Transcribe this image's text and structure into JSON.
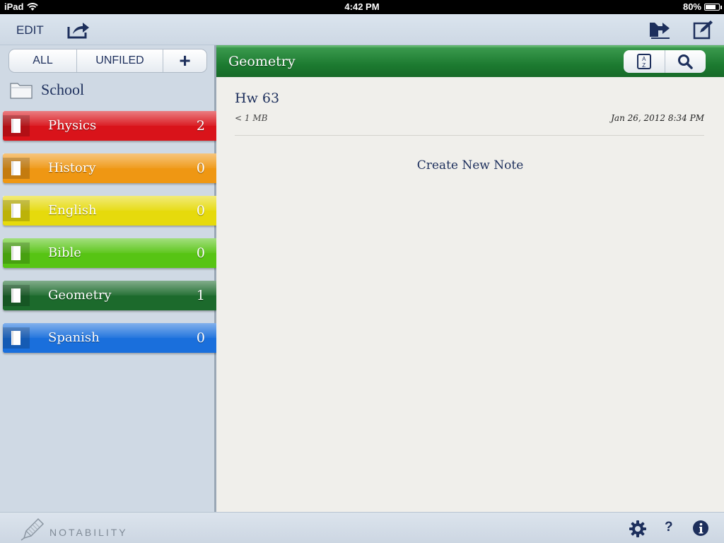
{
  "status_bar": {
    "carrier": "iPad",
    "time": "4:42 PM",
    "battery": "80%",
    "battery_level": 0.8
  },
  "toolbar": {
    "edit_label": "EDIT",
    "share_icon": "share-icon",
    "import_icon": "import-icon",
    "compose_icon": "compose-icon"
  },
  "sidebar": {
    "filters": {
      "all_label": "ALL",
      "unfiled_label": "UNFILED",
      "add_label": "+"
    },
    "category": {
      "label": "School",
      "icon": "folder-icon"
    },
    "subjects": [
      {
        "label": "Physics",
        "count": "2",
        "color": "#d9131a",
        "selected": false
      },
      {
        "label": "History",
        "count": "0",
        "color": "#ef9713",
        "selected": false
      },
      {
        "label": "English",
        "count": "0",
        "color": "#e6da0c",
        "selected": false
      },
      {
        "label": "Bible",
        "count": "0",
        "color": "#57c414",
        "selected": false
      },
      {
        "label": "Geometry",
        "count": "1",
        "color": "#1c6a2c",
        "selected": true
      },
      {
        "label": "Spanish",
        "count": "0",
        "color": "#1a6fdc",
        "selected": false
      }
    ]
  },
  "main": {
    "title": "Geometry",
    "header_color": "#1c7a30",
    "sort_icon": "sort-az-icon",
    "search_icon": "search-icon",
    "sort_glyph_top": "A",
    "sort_glyph_bottom": "Z",
    "notes": [
      {
        "title": "Hw 63",
        "size": "< 1 MB",
        "date": "Jan 26, 2012 8:34 PM"
      }
    ],
    "create_label": "Create New Note"
  },
  "bottom_bar": {
    "logo_text": "NOTABILITY",
    "settings_icon": "gear-icon",
    "help_label": "?",
    "info_icon": "info-icon"
  }
}
